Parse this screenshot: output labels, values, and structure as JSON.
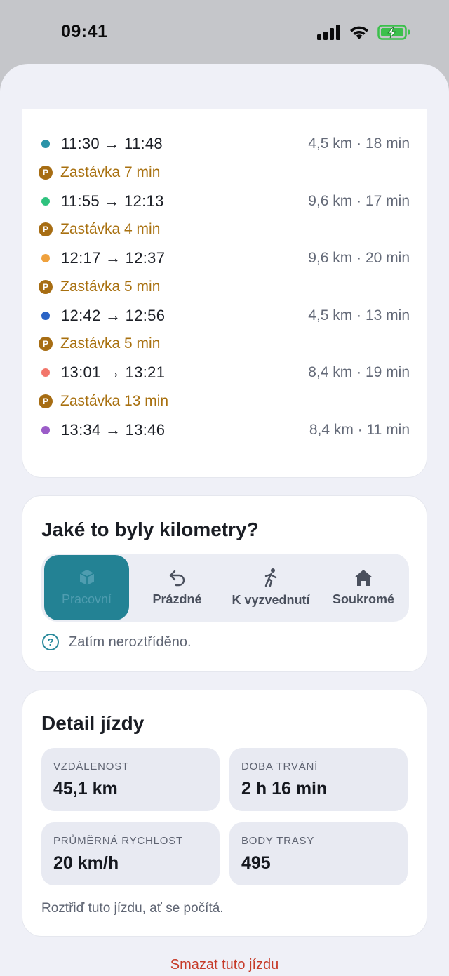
{
  "status": {
    "time": "09:41"
  },
  "segments": [
    {
      "kind": "drive",
      "color": "#2a93a8",
      "time": "11:30 → 11:48",
      "meta": "4,5 km · 18 min"
    },
    {
      "kind": "stop",
      "badge": "P",
      "label": "Zastávka 7 min"
    },
    {
      "kind": "drive",
      "color": "#2ec27e",
      "time": "11:55 → 12:13",
      "meta": "9,6 km · 17 min"
    },
    {
      "kind": "stop",
      "badge": "P",
      "label": "Zastávka 4 min"
    },
    {
      "kind": "drive",
      "color": "#efa13d",
      "time": "12:17 → 12:37",
      "meta": "9,6 km · 20 min"
    },
    {
      "kind": "stop",
      "badge": "P",
      "label": "Zastávka 5 min"
    },
    {
      "kind": "drive",
      "color": "#2b64c6",
      "time": "12:42 → 12:56",
      "meta": "4,5 km · 13 min"
    },
    {
      "kind": "stop",
      "badge": "P",
      "label": "Zastávka 5 min"
    },
    {
      "kind": "drive",
      "color": "#f2756a",
      "time": "13:01 → 13:21",
      "meta": "8,4 km · 19 min"
    },
    {
      "kind": "stop",
      "badge": "P",
      "label": "Zastávka 13 min"
    },
    {
      "kind": "drive",
      "color": "#9b5cc8",
      "time": "13:34 → 13:46",
      "meta": "8,4 km · 11 min"
    }
  ],
  "category": {
    "title": "Jaké to byly kilometry?",
    "options": [
      {
        "label": "Pracovní",
        "icon": "box-icon",
        "selected": true
      },
      {
        "label": "Prázdné",
        "icon": "return-arrow-icon",
        "selected": false
      },
      {
        "label": "K vyzvednutí",
        "icon": "walking-person-icon",
        "selected": false
      },
      {
        "label": "Soukromé",
        "icon": "home-icon",
        "selected": false
      }
    ],
    "hint_icon": "?",
    "hint": "Zatím neroztříděno."
  },
  "detail": {
    "title": "Detail jízdy",
    "tiles": [
      {
        "label": "VZDÁLENOST",
        "value": "45,1 km"
      },
      {
        "label": "DOBA TRVÁNÍ",
        "value": "2 h 16 min"
      },
      {
        "label": "PRŮMĚRNÁ RYCHLOST",
        "value": "20 km/h"
      },
      {
        "label": "BODY TRASY",
        "value": "495"
      }
    ],
    "note": "Roztřiď tuto jízdu, ať se počítá."
  },
  "delete_label": "Smazat tuto jízdu",
  "colors": {
    "accent": "#238294",
    "stop": "#a8700f",
    "danger": "#c63a28",
    "battery": "#3cc04c"
  }
}
